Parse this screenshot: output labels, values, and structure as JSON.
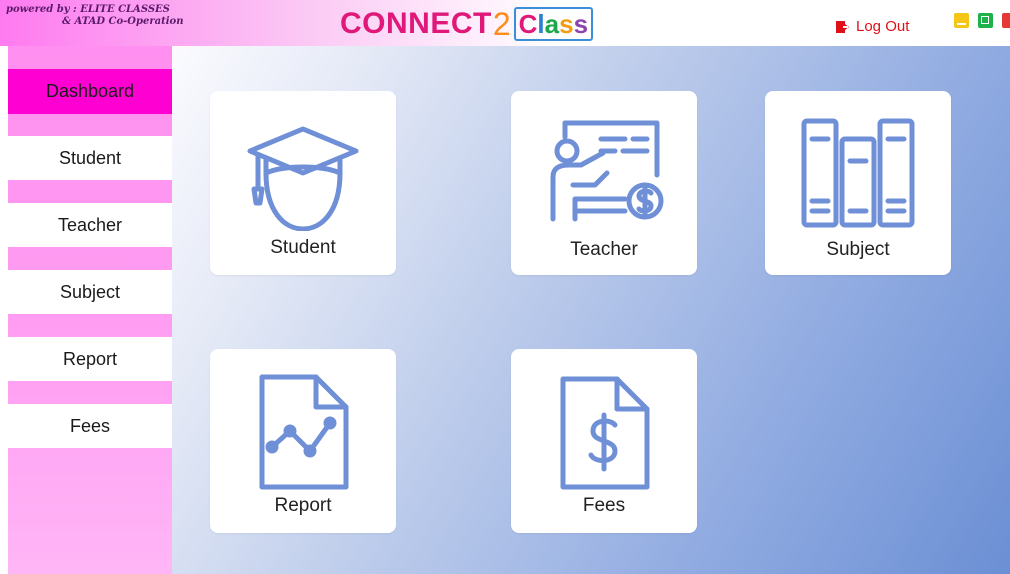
{
  "header": {
    "powered_by_line1": "powered by :   ELITE CLASSES",
    "powered_by_line2": "& ATAD Co-Operation",
    "brand_connect": "CONNECT",
    "brand_two": "2",
    "brand_class": [
      "C",
      "l",
      "a",
      "s",
      "s"
    ],
    "logout_label": "Log Out"
  },
  "sidebar": {
    "items": [
      {
        "label": "Dashboard",
        "active": true
      },
      {
        "label": "Student"
      },
      {
        "label": "Teacher"
      },
      {
        "label": "Subject"
      },
      {
        "label": "Report"
      },
      {
        "label": "Fees"
      }
    ]
  },
  "cards": [
    {
      "label": "Student",
      "icon": "graduate-icon"
    },
    {
      "label": "Teacher",
      "icon": "teacher-presentation-icon"
    },
    {
      "label": "Subject",
      "icon": "books-icon"
    },
    {
      "label": "Report",
      "icon": "report-chart-icon"
    },
    {
      "label": "Fees",
      "icon": "fees-document-icon"
    }
  ],
  "colors": {
    "active_sidebar": "#ff00d2",
    "sidebar_bg": "#ff9ff2",
    "icon_stroke": "#6f8fd6",
    "logout_red": "#e0101a"
  }
}
